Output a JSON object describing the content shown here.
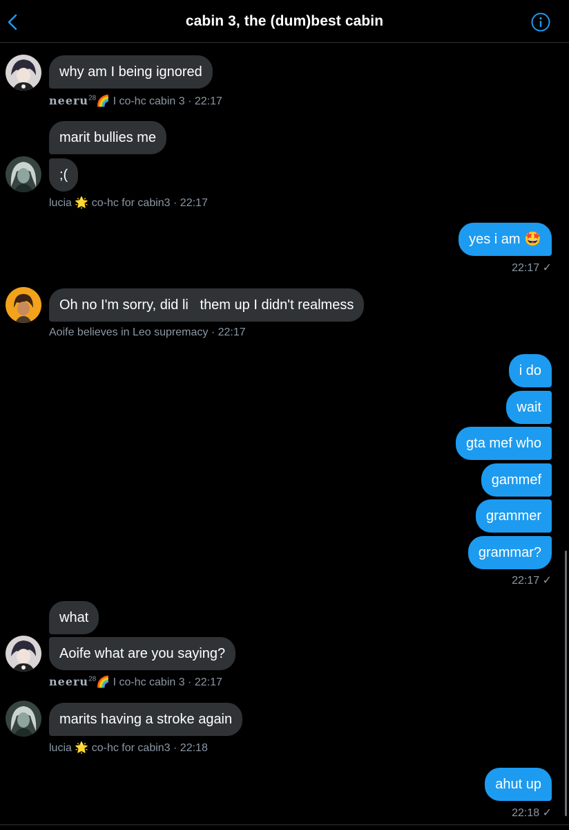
{
  "header": {
    "title": "cabin 3, the (dum)best cabin"
  },
  "messages": {
    "m1": {
      "text": "why am I being ignored"
    },
    "meta1": {
      "name": "neeru",
      "sup": "28",
      "emoji": "🌈",
      "role": "I co-hc cabin 3",
      "time": "· 22:17"
    },
    "m2": {
      "text": "marit bullies me"
    },
    "m3": {
      "text": ";("
    },
    "meta2": {
      "name": "lucia",
      "emoji": "🌟",
      "role": "co-hc for cabin3",
      "time": "· 22:17"
    },
    "m4": {
      "text": "yes i am 🤩"
    },
    "time1": "22:17 ✓",
    "m5": {
      "text": "Oh no I'm sorry, did li   them up I didn't realmess"
    },
    "meta3": {
      "role": "Aoife believes in Leo supremacy",
      "time": "· 22:17"
    },
    "m6": {
      "text": "i do"
    },
    "m7": {
      "text": "wait"
    },
    "m8": {
      "text": "gta mef who"
    },
    "m9": {
      "text": "gammef"
    },
    "m10": {
      "text": "grammer"
    },
    "m11": {
      "text": "grammar?"
    },
    "time2": "22:17 ✓",
    "m12": {
      "text": "what"
    },
    "m13": {
      "text": "Aoife what are you saying?"
    },
    "meta4": {
      "name": "neeru",
      "sup": "28",
      "emoji": "🌈",
      "role": "I co-hc cabin 3",
      "time": "· 22:17"
    },
    "m14": {
      "text": "marits having a stroke again"
    },
    "meta5": {
      "name": "lucia",
      "emoji": "🌟",
      "role": "co-hc for cabin3",
      "time": "· 22:18"
    },
    "m15": {
      "text": "ahut up"
    },
    "time3": "22:18 ✓"
  },
  "colors": {
    "accent": "#1d9bf0",
    "incoming_bubble": "#2f3336",
    "meta_text": "#8b98a5"
  },
  "icons": {
    "back": "chevron-left-icon",
    "info": "info-icon"
  }
}
